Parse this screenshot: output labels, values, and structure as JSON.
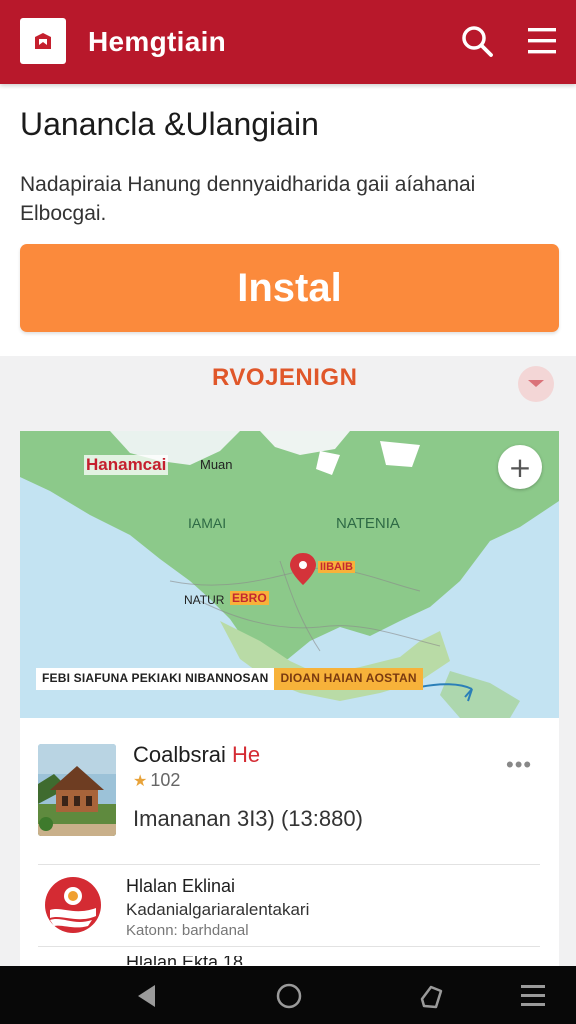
{
  "header": {
    "app_title": "Hemgtiain",
    "logo_icon": "app-logo-icon",
    "brand_color": "#b8182b",
    "search_icon": "search-icon",
    "menu_icon": "hamburger-menu-icon"
  },
  "main": {
    "heading": "Uanancla &Ulangiain",
    "description_line1": "Nadapiraia Hanung dennyaidharida gaii aíahanai",
    "description_line2": "Elbocgai.",
    "install_label": "Instal",
    "install_color": "#fb8a3c"
  },
  "section": {
    "title": "RVOJENIGN",
    "title_color": "#e0572a"
  },
  "map": {
    "city_label": "Hanamcai",
    "city_label_2": "Muan",
    "region_1": "IAMAI",
    "region_2": "NATENIA",
    "pin_label": "IIBAIB",
    "place_label": "NATUR",
    "place_tag": "EBRO",
    "zoom_symbol": "+",
    "route_from": "FEBI SIAFUNA PEKIAKI NIBANNOSAN",
    "route_to": "DIOAN HAIAN AOSTAN"
  },
  "listings": [
    {
      "title_main": "Coalbsrai ",
      "title_accent": "He",
      "rating": "102",
      "meta": "Imananan 3I3) (13:880)",
      "more_icon": "more-dots-icon"
    },
    {
      "title": "Hlalan Eklinai",
      "subtitle": "Kadanialgariaralentakari",
      "meta": "Katonn: barhdanal",
      "next_partial": "Hlalan Ekta 18"
    }
  ],
  "navbar": {
    "back_icon": "back-triangle-icon",
    "home_icon": "home-circle-icon",
    "recent_icon": "rotate-icon",
    "menu_icon": "nav-menu-icon"
  }
}
